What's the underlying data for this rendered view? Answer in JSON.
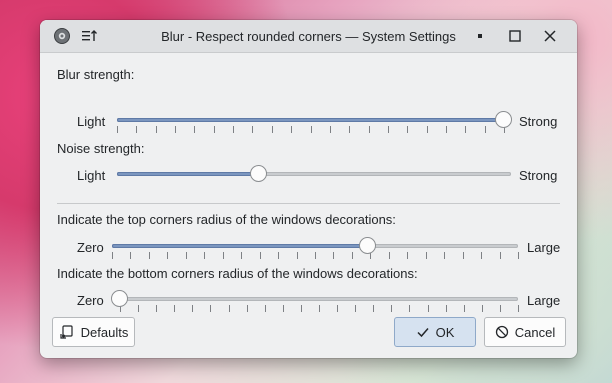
{
  "window": {
    "title": "Blur - Respect rounded corners — System Settings"
  },
  "blur": {
    "label": "Blur strength:",
    "min_label": "Light",
    "max_label": "Strong",
    "value": 1.0
  },
  "noise": {
    "label": "Noise strength:",
    "min_label": "Light",
    "max_label": "Strong",
    "value": 0.36
  },
  "top_radius": {
    "label": "Indicate the top corners radius of the windows decorations:",
    "min_label": "Zero",
    "max_label": "Large",
    "value": 0.63
  },
  "bottom_radius": {
    "label": "Indicate the bottom corners radius of the windows decorations:",
    "min_label": "Zero",
    "max_label": "Large",
    "value": 0.0
  },
  "buttons": {
    "defaults": "Defaults",
    "ok": "OK",
    "cancel": "Cancel"
  },
  "colors": {
    "accent": "#7b96bf",
    "window_bg": "#eff0f1",
    "titlebar_bg": "#dee0e2"
  }
}
